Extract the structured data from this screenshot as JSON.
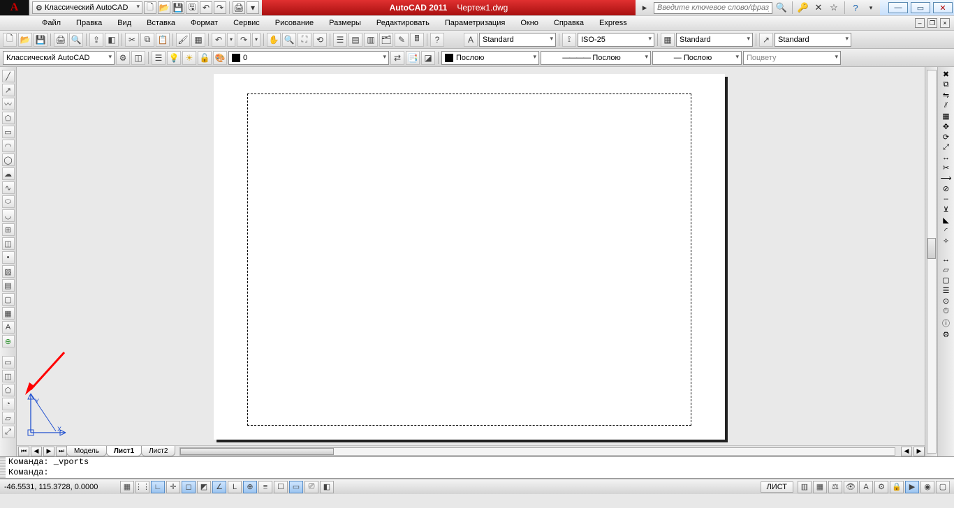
{
  "title": {
    "app": "AutoCAD 2011",
    "file": "Чертеж1.dwg"
  },
  "qat": {
    "workspace": "Классический AutoCAD"
  },
  "search": {
    "placeholder": "Введите ключевое слово/фразу"
  },
  "menu": [
    "Файл",
    "Правка",
    "Вид",
    "Вставка",
    "Формат",
    "Сервис",
    "Рисование",
    "Размеры",
    "Редактировать",
    "Параметризация",
    "Окно",
    "Справка",
    "Express"
  ],
  "row1": {
    "textstyle": "Standard",
    "dimstyle": "ISO-25",
    "tablestyle": "Standard",
    "mleaderstyle": "Standard"
  },
  "row2": {
    "workspace": "Классический AutoCAD",
    "layer": "0",
    "color": "Послою",
    "linetype": "Послою",
    "lineweight": "Послою",
    "plotstyle": "Поцвету"
  },
  "tabs": {
    "model": "Модель",
    "sheets": [
      "Лист1",
      "Лист2"
    ]
  },
  "cmd": {
    "line1": "Команда: _vports",
    "line2": "Команда:"
  },
  "status": {
    "coords": "-46.5531, 115.3728, 0.0000",
    "space": "ЛИСТ"
  }
}
